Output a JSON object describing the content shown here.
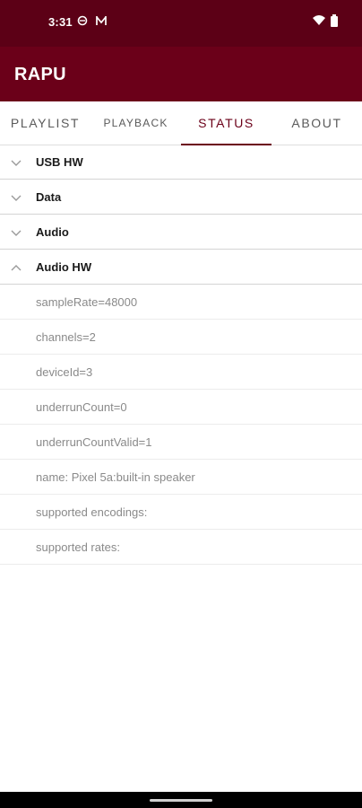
{
  "status_bar": {
    "time": "3:31"
  },
  "app_bar": {
    "title": "RAPU"
  },
  "tabs": [
    {
      "label": "PLAYLIST"
    },
    {
      "label": "PLAYBACK"
    },
    {
      "label": "STATUS"
    },
    {
      "label": "ABOUT"
    }
  ],
  "active_tab": "STATUS",
  "groups": [
    {
      "label": "USB HW",
      "expanded": false
    },
    {
      "label": "Data",
      "expanded": false
    },
    {
      "label": "Audio",
      "expanded": false
    },
    {
      "label": "Audio HW",
      "expanded": true
    }
  ],
  "audio_hw_details": [
    "sampleRate=48000",
    "channels=2",
    "deviceId=3",
    "underrunCount=0",
    "underrunCountValid=1",
    "name: Pixel 5a:built-in speaker",
    "supported encodings:",
    "supported rates:"
  ],
  "colors": {
    "status_bar": "#5c0016",
    "app_bar": "#6b0019",
    "accent": "#6b0019"
  },
  "icons": [
    "wifi-icon",
    "battery-icon",
    "chevron-down-icon",
    "chevron-up-icon"
  ]
}
